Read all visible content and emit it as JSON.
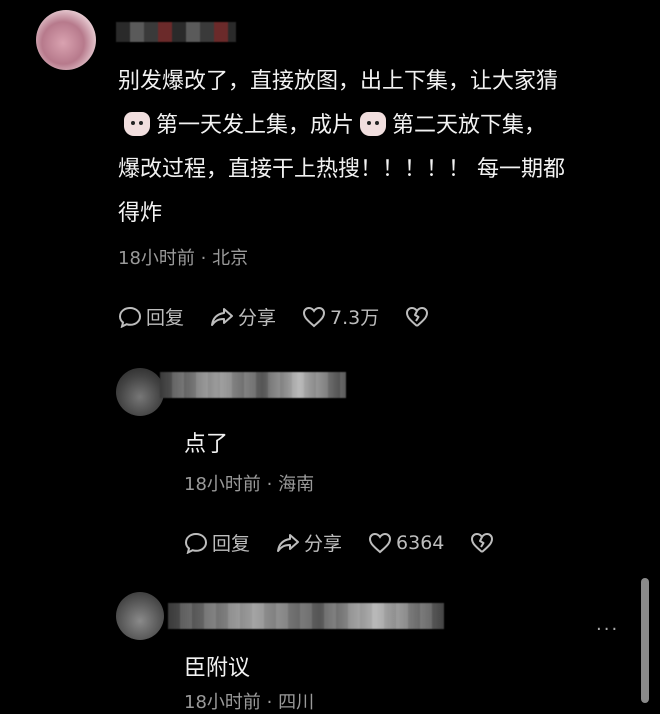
{
  "main_comment": {
    "text_line1": "别发爆改了，直接放图，出上下集，让大家猜",
    "text_line2a": "第一天发上集，成片",
    "text_line2b": "第二天放下集，",
    "text_line3": "爆改过程，直接干上热搜！！！！！ 每一期都",
    "text_line4": "得炸",
    "meta": "18小时前 · 北京",
    "reply_label": "回复",
    "share_label": "分享",
    "like_count": "7.3万"
  },
  "reply1": {
    "text": "点了",
    "meta": "18小时前 · 海南",
    "reply_label": "回复",
    "share_label": "分享",
    "like_count": "6364"
  },
  "reply2": {
    "text": "臣附议",
    "meta_partial": "18小时前 · 四川",
    "more_label": "..."
  },
  "icons": {
    "reply": "speech-bubble-icon",
    "share": "share-arrow-icon",
    "like": "heart-icon",
    "dislike": "broken-heart-icon",
    "emoji": "cat-face-emoji"
  },
  "colors": {
    "background": "#000000",
    "text": "#f2f2f2",
    "meta": "#9a9a9a"
  }
}
